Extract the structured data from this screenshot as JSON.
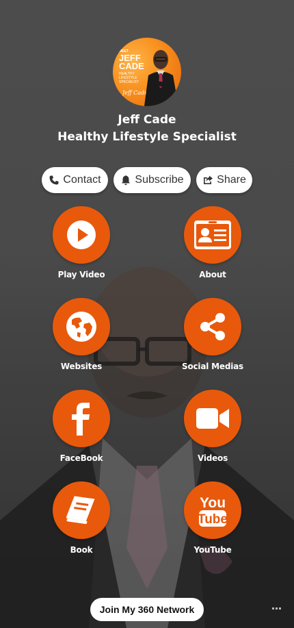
{
  "profile": {
    "meet_text": "MEET",
    "name_line1": "JEFF",
    "name_line2": "CADE",
    "tagline": "HEALTHY LIFESTYLE SPECIALIST",
    "signature": "Jeff Cade"
  },
  "header": {
    "name": "Jeff Cade",
    "title": "Healthy Lifestyle Specialist"
  },
  "actions": [
    {
      "label": "Contact",
      "icon": "phone-icon"
    },
    {
      "label": "Subscribe",
      "icon": "bell-icon"
    },
    {
      "label": "Share",
      "icon": "share-icon"
    }
  ],
  "tiles": [
    {
      "label": "Play Video",
      "icon": "play-icon"
    },
    {
      "label": "About",
      "icon": "id-card-icon"
    },
    {
      "label": "Websites",
      "icon": "globe-icon"
    },
    {
      "label": "Social Medias",
      "icon": "share-nodes-icon"
    },
    {
      "label": "FaceBook",
      "icon": "facebook-icon"
    },
    {
      "label": "Videos",
      "icon": "video-camera-icon"
    },
    {
      "label": "Book",
      "icon": "book-icon"
    },
    {
      "label": "YouTube",
      "icon": "youtube-icon"
    }
  ],
  "footer": {
    "join_label": "Join My 360 Network"
  },
  "colors": {
    "accent": "#e8590c",
    "background": "#4a4a4a"
  }
}
